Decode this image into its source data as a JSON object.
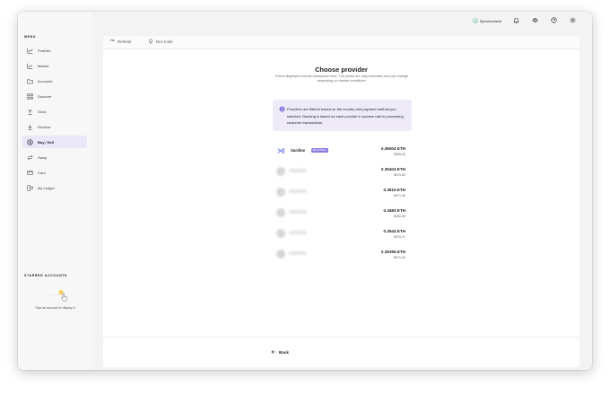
{
  "window": {
    "traffic": [
      "close",
      "minimize",
      "maximize"
    ]
  },
  "sidebar": {
    "menu_label": "MENU",
    "items": [
      {
        "label": "Portfolio",
        "icon": "chart-line-icon"
      },
      {
        "label": "Market",
        "icon": "trend-icon"
      },
      {
        "label": "Accounts",
        "icon": "folder-icon"
      },
      {
        "label": "Discover",
        "icon": "grid-icon"
      },
      {
        "label": "Send",
        "icon": "arrow-up-icon"
      },
      {
        "label": "Receive",
        "icon": "arrow-down-icon"
      },
      {
        "label": "Buy / Sell",
        "icon": "dollar-circle-icon",
        "active": true
      },
      {
        "label": "Swap",
        "icon": "swap-icon"
      },
      {
        "label": "Card",
        "icon": "card-icon"
      },
      {
        "label": "My Ledger",
        "icon": "device-icon"
      }
    ],
    "starred_label": "STARRED ACCOUNTS",
    "starred_hint": "Star an account to display it"
  },
  "topbar": {
    "sync_label": "Synchronized",
    "icons": [
      "bell-icon",
      "eye-icon",
      "help-icon",
      "settings-icon"
    ]
  },
  "toolbar": {
    "refresh_label": "Refresh",
    "devtools_label": "Dev tools"
  },
  "main": {
    "title": "Choose provider",
    "subtitle": "Prices displayed include transaction fees. The prices are only estimates and can change depending on market conditions.",
    "info_text": "Providers are filtered based on the country and payment method you selected. Ranking is based on each provider's success rate in processing customer transactions.",
    "providers": [
      {
        "name": "Sardine",
        "badge": "Best Price",
        "eth": "0.36004 ETH",
        "usd": "$585.55",
        "blurred": false
      },
      {
        "name": "",
        "badge": "",
        "eth": "0.35404 ETH",
        "usd": "$575.80",
        "blurred": true
      },
      {
        "name": "",
        "badge": "",
        "eth": "0.3515 ETH",
        "usd": "$571.66",
        "blurred": true
      },
      {
        "name": "",
        "badge": "",
        "eth": "0.3483 ETH",
        "usd": "$566.46",
        "blurred": true
      },
      {
        "name": "",
        "badge": "",
        "eth": "0.3544 ETH",
        "usd": "$576.37",
        "blurred": true
      },
      {
        "name": "",
        "badge": "",
        "eth": "0.35395 ETH",
        "usd": "$575.65",
        "blurred": true
      }
    ],
    "back_label": "Back"
  },
  "colors": {
    "accent": "#8b7be0",
    "active_bg": "#e9e7f8",
    "info_bg": "#eeeaf8",
    "success": "#3fb67d"
  }
}
